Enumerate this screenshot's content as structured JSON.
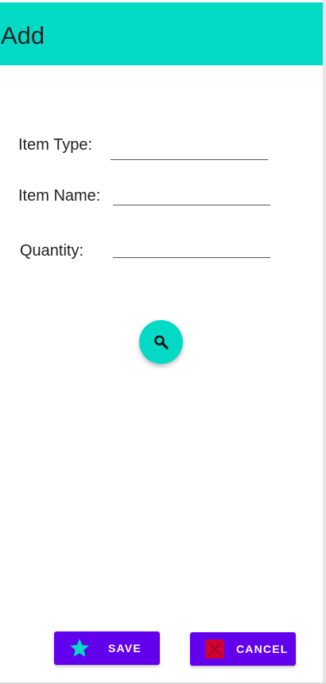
{
  "app_bar": {
    "title": "Add",
    "color": "#03dac5"
  },
  "form": {
    "item_type": {
      "label": "Item Type:",
      "value": ""
    },
    "item_name": {
      "label": "Item Name:",
      "value": ""
    },
    "quantity": {
      "label": "Quantity:",
      "value": ""
    }
  },
  "search_fab": {
    "icon": "search-icon",
    "color": "#03dac5"
  },
  "actions": {
    "save": {
      "label": "SAVE",
      "icon": "star-icon",
      "icon_color": "#03dac5"
    },
    "cancel": {
      "label": "CANCEL",
      "icon": "cancel-icon",
      "icon_color": "#d50032"
    },
    "button_color": "#6200ee"
  }
}
